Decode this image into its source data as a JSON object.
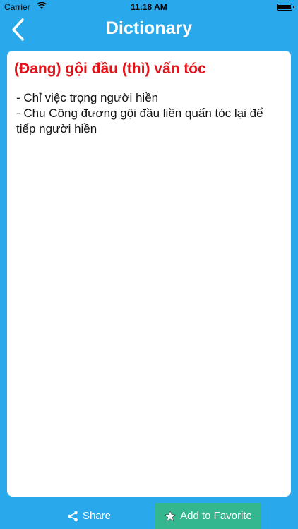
{
  "status_bar": {
    "carrier": "Carrier",
    "time": "11:18 AM"
  },
  "nav": {
    "title": "Dictionary",
    "back_icon": "chevron-left-icon"
  },
  "entry": {
    "headword": "(Đang) gội đầu (thì) vấn tóc",
    "definitions": [
      "- Chỉ việc trọng người hiền",
      "- Chu Công đương gội đầu liền quấn tóc lại để tiếp người hiền"
    ]
  },
  "actions": {
    "share_label": "Share",
    "favorite_label": "Add to Favorite"
  },
  "colors": {
    "nav_bg": "#29a9ec",
    "headword": "#e4131b",
    "share_button": "#29a9ec",
    "favorite_button": "#34b68f"
  },
  "icons": {
    "share": "share-icon",
    "favorite": "star-icon"
  }
}
